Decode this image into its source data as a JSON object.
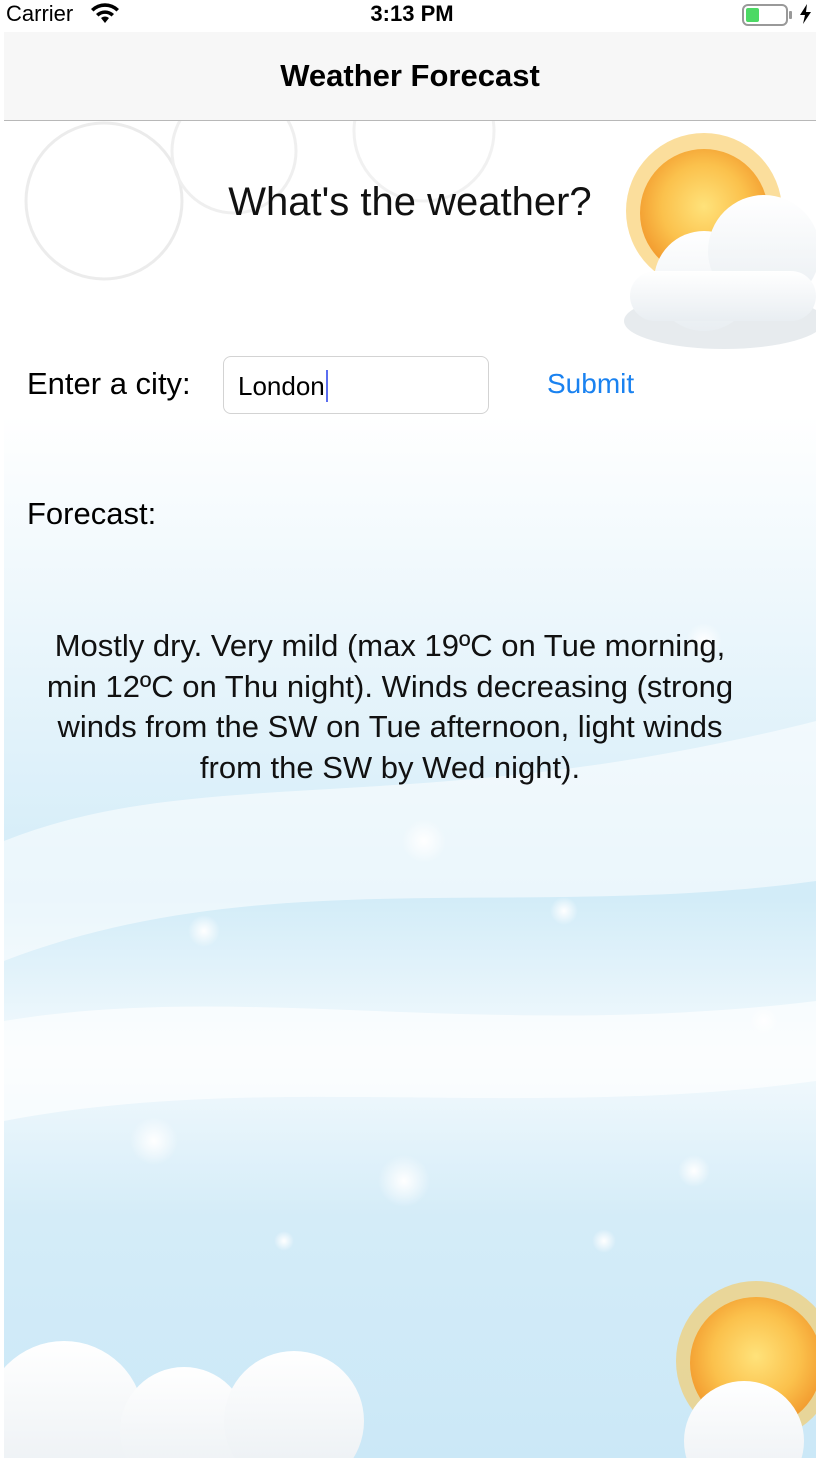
{
  "status_bar": {
    "carrier": "Carrier",
    "time": "3:13 PM",
    "icons": [
      "wifi-icon",
      "battery-icon",
      "charging-bolt-icon"
    ]
  },
  "nav": {
    "title": "Weather Forecast"
  },
  "main": {
    "heading": "What's the weather?",
    "city_label": "Enter a city:",
    "city_input_value": "London",
    "submit_label": "Submit",
    "forecast_label": "Forecast:",
    "forecast_text": "Mostly dry. Very mild (max 19ºC on Tue morning, min 12ºC on Thu night). Winds decreasing (strong winds from the SW on Tue afternoon, light winds from the SW by Wed night)."
  },
  "colors": {
    "accent": "#1a82f0",
    "nav_background": "#f7f7f7",
    "sky_blue": "#cbe8f7",
    "sun_orange": "#f6a83a",
    "battery_green": "#4cd964"
  }
}
